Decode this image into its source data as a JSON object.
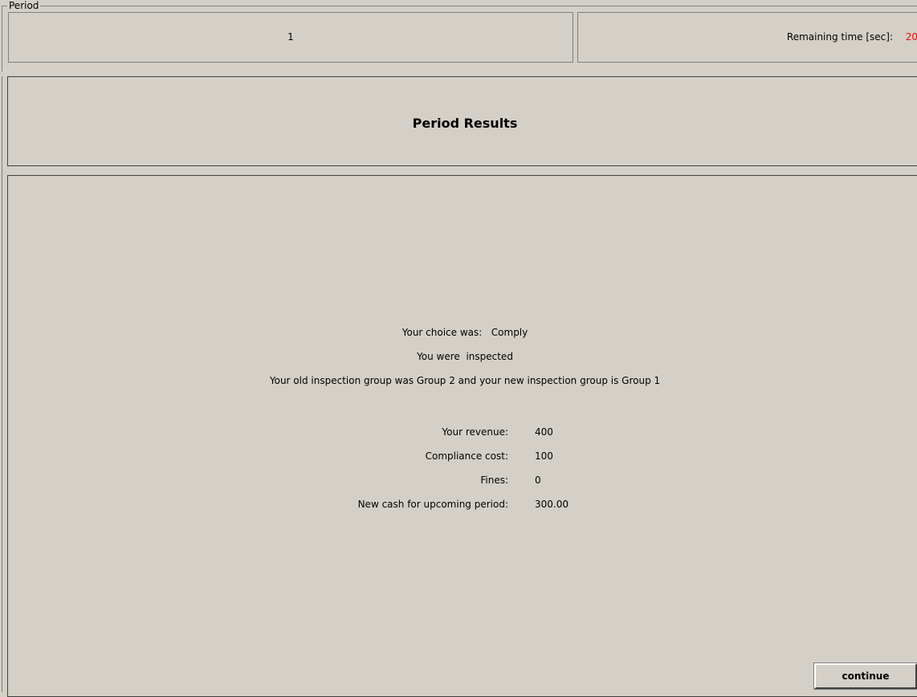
{
  "period": {
    "legend": "Period",
    "value": "1"
  },
  "timer": {
    "label": "Remaining time [sec]:",
    "value": "20",
    "value_color": "#ff0000"
  },
  "header": {
    "title": "Period Results"
  },
  "results": {
    "choice_label": "Your choice was:",
    "choice_value": "Comply",
    "inspection_text": "You were  inspected",
    "group_text": "Your old inspection group was Group 2 and your new inspection group is Group 1",
    "rows": [
      {
        "label": "Your revenue:",
        "value": "400"
      },
      {
        "label": "Compliance cost:",
        "value": "100"
      },
      {
        "label": "Fines:",
        "value": "0"
      },
      {
        "label": "New cash for upcoming period:",
        "value": "300.00"
      }
    ]
  },
  "actions": {
    "continue_label": "continue"
  }
}
